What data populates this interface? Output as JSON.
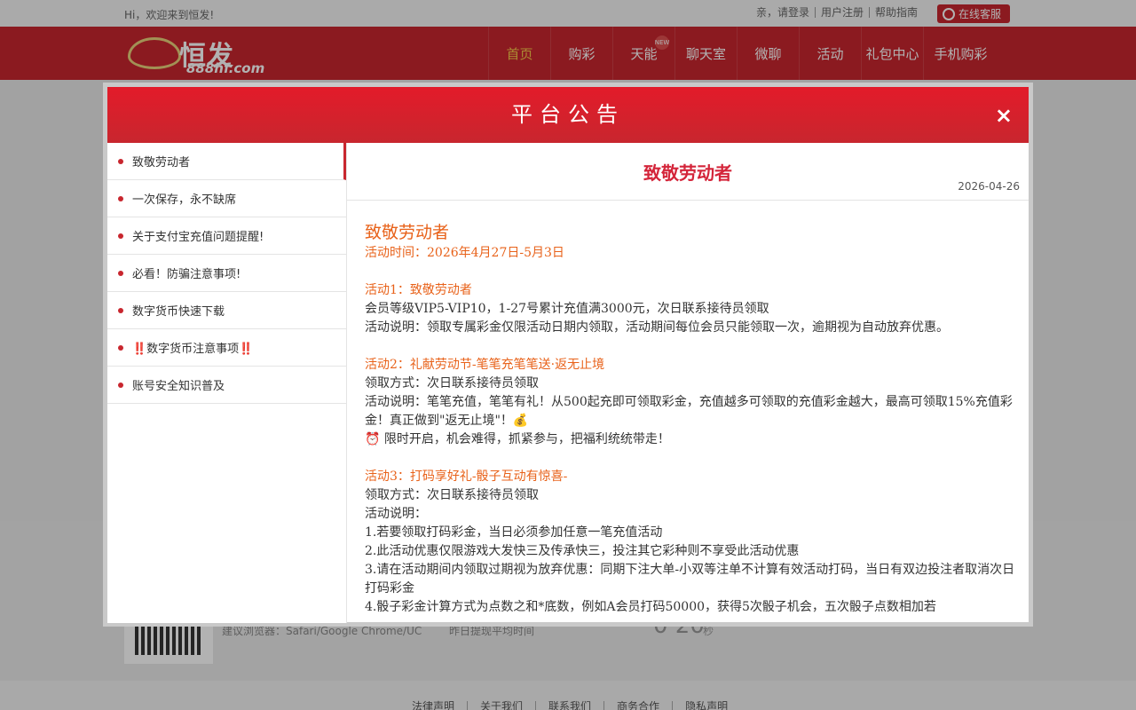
{
  "topbar": {
    "welcome": "Hi，欢迎来到恒发!",
    "links": [
      "亲，请登录",
      "用户注册",
      "帮助指南"
    ],
    "cs_label": "在线客服"
  },
  "header": {
    "logo_text": "恒发",
    "logo_sub": "888hf.com",
    "nav": [
      {
        "label": "首页"
      },
      {
        "label": "购彩"
      },
      {
        "label": "天能",
        "badge": "NEW"
      },
      {
        "label": "聊天室"
      },
      {
        "label": "微聊"
      },
      {
        "label": "活动"
      },
      {
        "label": "礼包中心"
      },
      {
        "label": "手机购彩"
      }
    ]
  },
  "background": {
    "browser_tip": "建议浏览器：Safari/Google Chrome/UC",
    "withdraw_tip": "昨日提现平均时间",
    "withdraw_value": "0 20",
    "withdraw_unit": "秒",
    "footer_links": [
      "法律声明",
      "关于我们",
      "联系我们",
      "商务合作",
      "隐私声明"
    ]
  },
  "modal": {
    "title": "平台公告",
    "close": "×",
    "sidebar": [
      "致敬劳动者",
      "一次保存，永不缺席",
      "关于支付宝充值问题提醒!",
      "必看！防骗注意事项!",
      "数字货币快速下载",
      "‼️数字货币注意事项‼️",
      "账号安全知识普及"
    ],
    "article": {
      "title": "致敬劳动者",
      "date": "2026-04-26",
      "heading": "致敬劳动者",
      "time": "活动时间：2026年4月27日-5月3日",
      "a1_title": "活动1：致敬劳动者",
      "a1_l1": "会员等级VIP5-VIP10，1-27号累计充值满3000元，次日联系接待员领取",
      "a1_l2": "活动说明：领取专属彩金仅限活动日期内领取，活动期间每位会员只能领取一次，逾期视为自动放弃优惠。",
      "a2_title": "活动2：礼献劳动节-笔笔充笔笔送·返无止境",
      "a2_l1": "领取方式：次日联系接待员领取",
      "a2_l2": "活动说明：笔笔充值，笔笔有礼！从500起充即可领取彩金，充值越多可领取的充值彩金越大，最高可领取15%充值彩金！真正做到\"返无止境\"！💰",
      "a2_l3": "⏰ 限时开启，机会难得，抓紧参与，把福利统统带走！",
      "a3_title": "活动3：打码享好礼-骰子互动有惊喜-",
      "a3_l1": "领取方式：次日联系接待员领取",
      "a3_l2": "活动说明：",
      "a3_l3": "1.若要领取打码彩金，当日必须参加任意一笔充值活动",
      "a3_l4": "2.此活动优惠仅限游戏大发快三及传承快三，投注其它彩种则不享受此活动优惠",
      "a3_l5": "3.请在活动期间内领取过期视为放弃优惠：同期下注大单-小双等注单不计算有效活动打码，当日有双边投注者取消次日打码彩金",
      "a3_l6": "4.骰子彩金计算方式为点数之和*底数，例如A会员打码50000，获得5次骰子机会，五次骰子点数相加若"
    }
  }
}
